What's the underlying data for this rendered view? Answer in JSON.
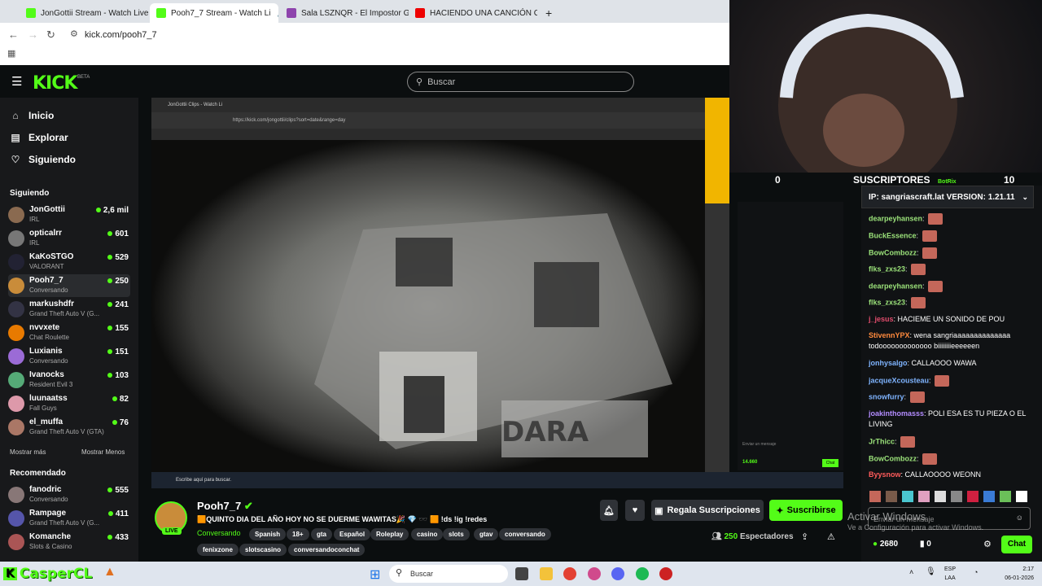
{
  "browser": {
    "tabs": [
      {
        "label": "JonGottii Stream - Watch Live o",
        "color": "#53fc18"
      },
      {
        "label": "Pooh7_7 Stream - Watch Li",
        "color": "#53fc18"
      },
      {
        "label": "Sala LSZNQR - El Impostor Gam",
        "color": "#8e44ad"
      },
      {
        "label": "HACIENDO UNA CANCIÓN CO",
        "color": "#e00"
      }
    ],
    "new_tab": "+",
    "url": "kick.com/pooh7_7"
  },
  "header": {
    "logo": "KICK",
    "beta": "BETA",
    "search_placeholder": "Buscar"
  },
  "nav": [
    {
      "label": "Inicio",
      "icon": "⌂"
    },
    {
      "label": "Explorar",
      "icon": "▤"
    },
    {
      "label": "Siguiendo",
      "icon": "♡"
    }
  ],
  "following": {
    "heading": "Siguiendo",
    "channels": [
      {
        "name": "JonGottii",
        "sub": "IRL",
        "viewers": "2,6 mil",
        "color": "#8a6a50"
      },
      {
        "name": "opticalrr",
        "sub": "IRL",
        "viewers": "601",
        "color": "#777"
      },
      {
        "name": "KaKoSTGO",
        "sub": "VALORANT",
        "viewers": "529",
        "color": "#223"
      },
      {
        "name": "Pooh7_7",
        "sub": "Conversando",
        "viewers": "250",
        "color": "#c98c3a"
      },
      {
        "name": "markushdfr",
        "sub": "Grand Theft Auto V (G...",
        "viewers": "241",
        "color": "#334"
      },
      {
        "name": "nvvxete",
        "sub": "Chat Roulette",
        "viewers": "155",
        "color": "#e87a00"
      },
      {
        "name": "Luxianis",
        "sub": "Conversando",
        "viewers": "151",
        "color": "#9b6bd6"
      },
      {
        "name": "Ivanocks",
        "sub": "Resident Evil 3",
        "viewers": "103",
        "color": "#5a7"
      },
      {
        "name": "luunaatss",
        "sub": "Fall Guys",
        "viewers": "82",
        "color": "#d9a"
      },
      {
        "name": "el_muffa",
        "sub": "Grand Theft Auto V (GTA)",
        "viewers": "76",
        "color": "#a76"
      }
    ],
    "show_more": "Mostrar más",
    "show_less": "Mostrar Menos"
  },
  "recommended": {
    "heading": "Recomendado",
    "channels": [
      {
        "name": "fanodric",
        "sub": "Conversando",
        "viewers": "555",
        "color": "#877"
      },
      {
        "name": "Rampage",
        "sub": "Grand Theft Auto V (G...",
        "viewers": "411",
        "color": "#55a"
      },
      {
        "name": "Komanche",
        "sub": "Slots & Casino",
        "viewers": "433",
        "color": "#a55"
      }
    ]
  },
  "video": {
    "inner_tab": "JonGottii Clips - Watch Li",
    "inner_url": "https://kick.com/jongottii/clips?sort=date&range=day",
    "inner_taskbar_search": "Escribe aquí para buscar.",
    "inner_chat_placeholder": "Enviar un mensaje",
    "inner_chat_count": "14.660",
    "inner_chat_btn": "Chat"
  },
  "overlay": {
    "left_count": "0",
    "subs_label": "SUSCRIPTORES",
    "right_count": "10"
  },
  "chat": {
    "ip_bar": "IP: sangriascraft.lat VERSION: 1.21.11",
    "botrix": "BotRix",
    "messages": [
      {
        "user": "dearpeyhansen",
        "text": "",
        "color": "#9be27a",
        "emote": true
      },
      {
        "user": "BuckEssence",
        "text": "",
        "color": "#9be27a",
        "emote": true
      },
      {
        "user": "BowCombozz",
        "text": "",
        "color": "#9be27a",
        "emote": true
      },
      {
        "user": "flks_zxs23",
        "text": "",
        "color": "#9be27a",
        "emote": true
      },
      {
        "user": "dearpeyhansen",
        "text": "",
        "color": "#9be27a",
        "emote": true
      },
      {
        "user": "flks_zxs23",
        "text": "",
        "color": "#9be27a",
        "emote": true
      },
      {
        "user": "j_jesus",
        "text": "HACIEME UN SONIDO DE POU",
        "color": "#e14c6c",
        "emote": false
      },
      {
        "user": "StivennYPX",
        "text": "wena sangriaaaaaaaaaaaaaa todooooooooooooo biiiiiiiieeeeeen",
        "color": "#ff8a3d",
        "emote": false
      },
      {
        "user": "jonhysalgo",
        "text": "CALLAOOO WAWA",
        "color": "#7fb4ff",
        "emote": false
      },
      {
        "user": "jacqueXcousteau",
        "text": "",
        "color": "#7fb4ff",
        "emote": true
      },
      {
        "user": "snowfurry",
        "text": "",
        "color": "#7fb4ff",
        "emote": true
      },
      {
        "user": "joakinthomasss",
        "text": "POLI ESA ES TU PIEZA O EL LIVING",
        "color": "#b38cff",
        "emote": false
      },
      {
        "user": "JrThicc",
        "text": "",
        "color": "#9be27a",
        "emote": true
      },
      {
        "user": "BowCombozz",
        "text": "",
        "color": "#9be27a",
        "emote": true
      },
      {
        "user": "Byysnow",
        "text": "CALLAOOOO WEONN",
        "color": "#ff5b5b",
        "emote": false
      }
    ],
    "input_placeholder": "Enviar un mensaje",
    "points": "2680",
    "gifted": "0",
    "send": "Chat"
  },
  "stream": {
    "name": "Pooh7_7",
    "live": "LIVE",
    "title": "🟧QUINTO DIA DEL AÑO HOY NO SE DUERME WAWITAS🎉 💎 🕶️ 🟧 !ds !ig !redes",
    "category": "Conversando",
    "tags": [
      "Spanish",
      "18+",
      "gta",
      "Español",
      "Roleplay",
      "casino",
      "slots",
      "gtav",
      "conversando",
      "fenixzone",
      "slotscasino",
      "conversandoconchat"
    ],
    "gift_subs": "Regala Suscripciones",
    "subscribe": "Suscribirse",
    "viewers_count": "250",
    "viewers_label": "Espectadores"
  },
  "watermark": {
    "line1": "Activar Windows",
    "line2": "Ve a Configuración para activar Windows."
  },
  "taskbar": {
    "search": "Buscar",
    "lang1": "ESP",
    "lang2": "LAA",
    "time": "2:17",
    "date": "06-01-2026",
    "casper": "CasperCL"
  }
}
